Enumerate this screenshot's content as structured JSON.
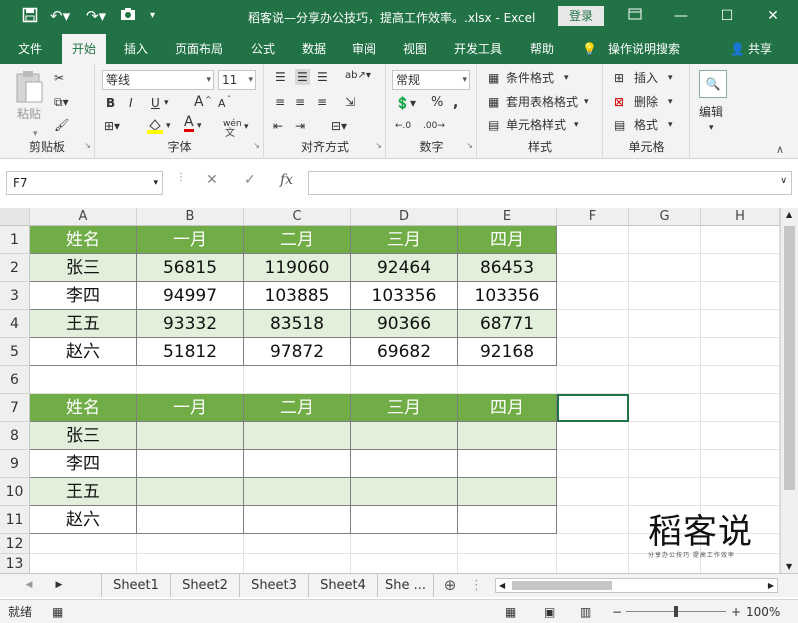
{
  "titlebar": {
    "title": "稻客说—分享办公技巧，提高工作效率。.xlsx - Excel",
    "login": "登录"
  },
  "menu": {
    "tabs": [
      "文件",
      "开始",
      "插入",
      "页面布局",
      "公式",
      "数据",
      "审阅",
      "视图",
      "开发工具",
      "帮助"
    ],
    "tell_me": "操作说明搜索",
    "share": "共享"
  },
  "ribbon": {
    "clipboard": {
      "paste": "粘贴",
      "label": "剪贴板"
    },
    "font": {
      "name": "等线",
      "size": "11",
      "bold": "B",
      "italic": "I",
      "underline": "U",
      "grow": "A",
      "shrink": "A",
      "color": "A",
      "phonetic": "wén",
      "label": "字体"
    },
    "alignment": {
      "label": "对齐方式"
    },
    "number": {
      "format": "常规",
      "label": "数字"
    },
    "styles": {
      "conditional": "条件格式",
      "table": "套用表格格式",
      "cell": "单元格样式",
      "label": "样式"
    },
    "cells": {
      "insert": "插入",
      "delete": "删除",
      "format": "格式",
      "label": "单元格"
    },
    "editing": {
      "label": "编辑"
    }
  },
  "formula_bar": {
    "name_box": "F7",
    "fx": "fx",
    "content": ""
  },
  "columns": [
    "A",
    "B",
    "C",
    "D",
    "E",
    "F",
    "G",
    "H"
  ],
  "rows": [
    "1",
    "2",
    "3",
    "4",
    "5",
    "6",
    "7",
    "8",
    "9",
    "10",
    "11",
    "12",
    "13"
  ],
  "table1": {
    "header": [
      "姓名",
      "一月",
      "二月",
      "三月",
      "四月"
    ],
    "rows": [
      [
        "张三",
        "56815",
        "119060",
        "92464",
        "86453"
      ],
      [
        "李四",
        "94997",
        "103885",
        "103356",
        "103356"
      ],
      [
        "王五",
        "93332",
        "83518",
        "90366",
        "68771"
      ],
      [
        "赵六",
        "51812",
        "97872",
        "69682",
        "92168"
      ]
    ]
  },
  "table2": {
    "header": [
      "姓名",
      "一月",
      "二月",
      "三月",
      "四月"
    ],
    "rows": [
      [
        "张三"
      ],
      [
        "李四"
      ],
      [
        "王五"
      ],
      [
        "赵六"
      ]
    ]
  },
  "watermark": {
    "brand": "稻客说",
    "tagline": "分享办公技巧 提高工作效率"
  },
  "sheets": [
    "Sheet1",
    "Sheet2",
    "Sheet3",
    "Sheet4",
    "She ..."
  ],
  "status": {
    "ready": "就绪",
    "zoom": "100%"
  },
  "colors": {
    "excel_green": "#217346",
    "header_fill": "#70ad47",
    "band_fill": "#e2efda"
  }
}
